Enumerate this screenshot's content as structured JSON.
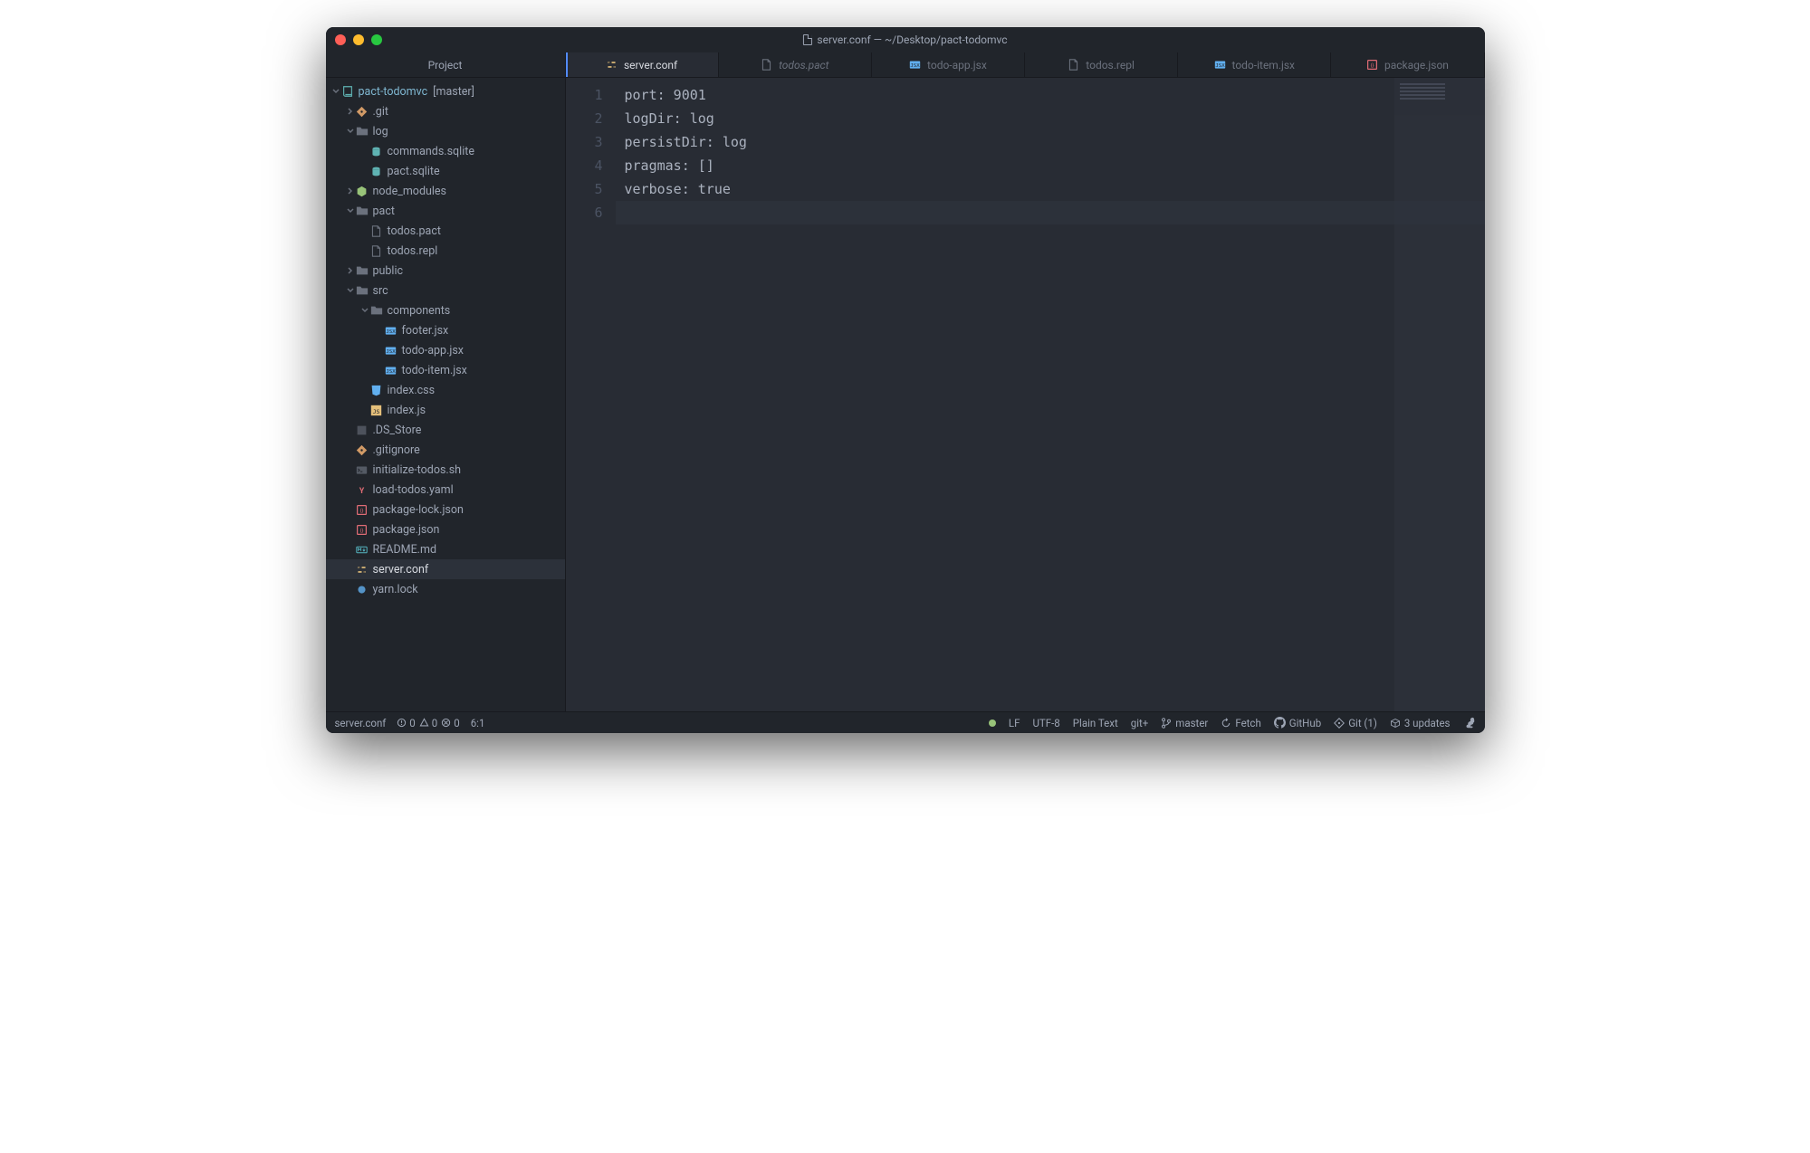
{
  "title": "server.conf — ~/Desktop/pact-todomvc",
  "sidebar": {
    "header": "Project",
    "root": {
      "label": "pact-todomvc",
      "branch": "[master]"
    },
    "items": [
      {
        "label": ".git",
        "indent": 1,
        "chevron": "right",
        "icon": "git",
        "color": "c-orange"
      },
      {
        "label": "log",
        "indent": 1,
        "chevron": "down",
        "icon": "folder",
        "color": "c-gray"
      },
      {
        "label": "commands.sqlite",
        "indent": 2,
        "chevron": "",
        "icon": "db",
        "color": "c-teal"
      },
      {
        "label": "pact.sqlite",
        "indent": 2,
        "chevron": "",
        "icon": "db",
        "color": "c-teal"
      },
      {
        "label": "node_modules",
        "indent": 1,
        "chevron": "right",
        "icon": "node",
        "color": "c-green"
      },
      {
        "label": "pact",
        "indent": 1,
        "chevron": "down",
        "icon": "folder",
        "color": "c-gray"
      },
      {
        "label": "todos.pact",
        "indent": 2,
        "chevron": "",
        "icon": "file",
        "color": "c-gray"
      },
      {
        "label": "todos.repl",
        "indent": 2,
        "chevron": "",
        "icon": "file",
        "color": "c-gray"
      },
      {
        "label": "public",
        "indent": 1,
        "chevron": "right",
        "icon": "folder",
        "color": "c-gray"
      },
      {
        "label": "src",
        "indent": 1,
        "chevron": "down",
        "icon": "folder",
        "color": "c-gray"
      },
      {
        "label": "components",
        "indent": 2,
        "chevron": "down",
        "icon": "folder",
        "color": "c-gray"
      },
      {
        "label": "footer.jsx",
        "indent": 3,
        "chevron": "",
        "icon": "jsx",
        "color": "c-blue"
      },
      {
        "label": "todo-app.jsx",
        "indent": 3,
        "chevron": "",
        "icon": "jsx",
        "color": "c-blue"
      },
      {
        "label": "todo-item.jsx",
        "indent": 3,
        "chevron": "",
        "icon": "jsx",
        "color": "c-blue"
      },
      {
        "label": "index.css",
        "indent": 2,
        "chevron": "",
        "icon": "css",
        "color": "c-blue"
      },
      {
        "label": "index.js",
        "indent": 2,
        "chevron": "",
        "icon": "js",
        "color": "c-yellow"
      },
      {
        "label": ".DS_Store",
        "indent": 1,
        "chevron": "",
        "icon": "bin",
        "color": "c-gray"
      },
      {
        "label": ".gitignore",
        "indent": 1,
        "chevron": "",
        "icon": "git",
        "color": "c-orange"
      },
      {
        "label": "initialize-todos.sh",
        "indent": 1,
        "chevron": "",
        "icon": "sh",
        "color": "c-gray"
      },
      {
        "label": "load-todos.yaml",
        "indent": 1,
        "chevron": "",
        "icon": "yaml",
        "color": "c-red"
      },
      {
        "label": "package-lock.json",
        "indent": 1,
        "chevron": "",
        "icon": "json",
        "color": "c-red"
      },
      {
        "label": "package.json",
        "indent": 1,
        "chevron": "",
        "icon": "json",
        "color": "c-red"
      },
      {
        "label": "README.md",
        "indent": 1,
        "chevron": "",
        "icon": "md",
        "color": "c-cyan"
      },
      {
        "label": "server.conf",
        "indent": 1,
        "chevron": "",
        "icon": "conf",
        "color": "c-yellow",
        "selected": true
      },
      {
        "label": "yarn.lock",
        "indent": 1,
        "chevron": "",
        "icon": "lock",
        "color": "c-blue"
      }
    ]
  },
  "tabs": [
    {
      "label": "server.conf",
      "icon": "conf",
      "color": "c-yellow",
      "active": true
    },
    {
      "label": "todos.pact",
      "icon": "file",
      "color": "c-gray",
      "modified": true
    },
    {
      "label": "todo-app.jsx",
      "icon": "jsx",
      "color": "c-blue"
    },
    {
      "label": "todos.repl",
      "icon": "file",
      "color": "c-gray"
    },
    {
      "label": "todo-item.jsx",
      "icon": "jsx",
      "color": "c-blue"
    },
    {
      "label": "package.json",
      "icon": "json",
      "color": "c-red"
    }
  ],
  "editor": {
    "lines": [
      "port: 9001",
      "logDir: log",
      "persistDir: log",
      "pragmas: []",
      "verbose: true",
      ""
    ],
    "current_line_index": 5
  },
  "status": {
    "left": {
      "filename": "server.conf",
      "diag_info": "0",
      "diag_warn": "0",
      "diag_error": "0",
      "cursor": "6:1"
    },
    "right": {
      "line_ending": "LF",
      "encoding": "UTF-8",
      "grammar": "Plain Text",
      "git_status": "git+",
      "branch": "master",
      "fetch": "Fetch",
      "github": "GitHub",
      "git_count": "Git (1)",
      "updates": "3 updates"
    }
  }
}
